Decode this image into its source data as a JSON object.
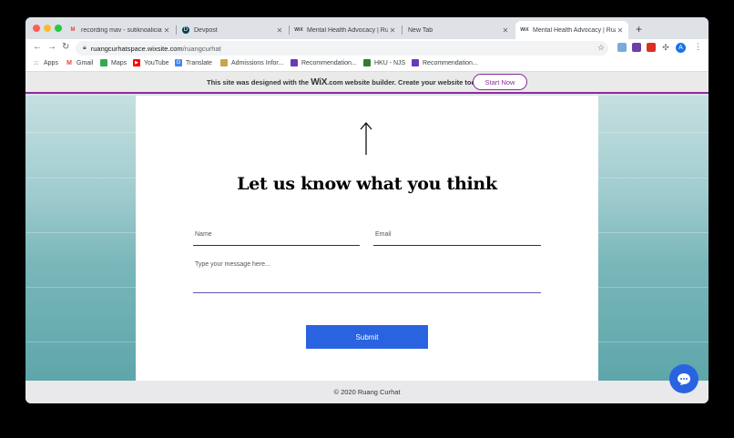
{
  "browser": {
    "tabs": [
      {
        "title": "recording mav - sutiknoaliciap",
        "favicon": "gmail-icon"
      },
      {
        "title": "Devpost",
        "favicon": "devpost-icon"
      },
      {
        "title": "Mental Health Advocacy | Ruang",
        "favicon": "wix-icon"
      },
      {
        "title": "New Tab",
        "favicon": ""
      },
      {
        "title": "Mental Health Advocacy | Ruang",
        "favicon": "wix-icon",
        "active": true
      }
    ],
    "url_host": "ruangcurhatspace.wixsite.com",
    "url_path": "/ruangcurhat",
    "profile_initial": "A",
    "bookmarks": [
      {
        "label": "Apps",
        "icon": "apps-grid-icon"
      },
      {
        "label": "Gmail",
        "icon": "gmail-icon"
      },
      {
        "label": "Maps",
        "icon": "maps-icon"
      },
      {
        "label": "YouTube",
        "icon": "youtube-icon"
      },
      {
        "label": "Translate",
        "icon": "translate-icon"
      },
      {
        "label": "Admissions Infor...",
        "icon": "university-icon"
      },
      {
        "label": "Recommendation...",
        "icon": "form-icon"
      },
      {
        "label": "HKU - NJS",
        "icon": "university-icon"
      },
      {
        "label": "Recommendation...",
        "icon": "form-icon"
      }
    ]
  },
  "banner": {
    "text_before": "This site was designed with the ",
    "wix_logo": "WiX",
    "text_after": ".com website builder. Create your website today.",
    "cta": "Start Now"
  },
  "form": {
    "heading": "Let us know what you think",
    "name_placeholder": "Name",
    "email_placeholder": "Email",
    "message_placeholder": "Type your message here...",
    "submit_label": "Submit"
  },
  "footer": {
    "copyright": "© 2020 Ruang Curhat"
  },
  "colors": {
    "accent": "#8a2d9b",
    "button": "#2a63e0"
  }
}
